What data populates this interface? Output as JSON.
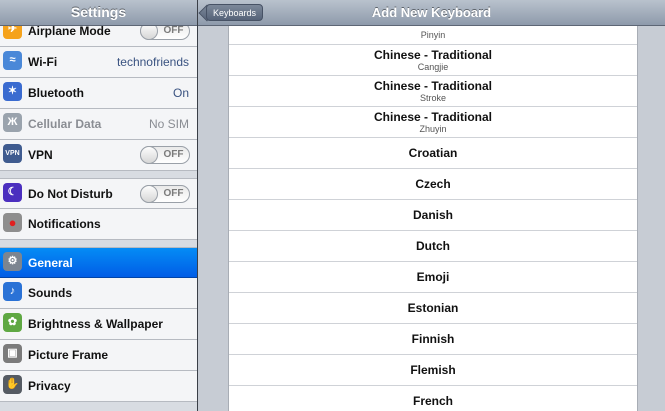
{
  "sidebar": {
    "title": "Settings",
    "items": [
      {
        "label": "Airplane Mode",
        "icon": "airplane-icon",
        "icon_color": "#f5a21b",
        "toggle": "OFF"
      },
      {
        "label": "Wi-Fi",
        "icon": "wifi-icon",
        "icon_color": "#4a88d8",
        "value": "technofriends"
      },
      {
        "label": "Bluetooth",
        "icon": "bluetooth-icon",
        "icon_color": "#3a6bd0",
        "value": "On"
      },
      {
        "label": "Cellular Data",
        "icon": "antenna-icon",
        "icon_color": "#9aa3ad",
        "value": "No SIM",
        "disabled": true
      },
      {
        "label": "VPN",
        "icon": "vpn-icon",
        "icon_color": "#3f5b8f",
        "toggle": "OFF"
      },
      {
        "label": "Do Not Disturb",
        "icon": "moon-icon",
        "icon_color": "#4b2fbf",
        "toggle": "OFF"
      },
      {
        "label": "Notifications",
        "icon": "notifications-icon",
        "icon_color": "#8e8e8e"
      },
      {
        "label": "General",
        "icon": "gear-icon",
        "icon_color": "#7c8590",
        "selected": true
      },
      {
        "label": "Sounds",
        "icon": "speaker-icon",
        "icon_color": "#2a72d6"
      },
      {
        "label": "Brightness & Wallpaper",
        "icon": "brightness-wallpaper-icon",
        "icon_color": "#5fa843"
      },
      {
        "label": "Picture Frame",
        "icon": "picture-frame-icon",
        "icon_color": "#7b7b7b"
      },
      {
        "label": "Privacy",
        "icon": "hand-icon",
        "icon_color": "#555b63"
      }
    ]
  },
  "navbar": {
    "back_label": "Keyboards",
    "title": "Add New Keyboard"
  },
  "keyboards": [
    {
      "name": "",
      "sub": "Pinyin"
    },
    {
      "name": "Chinese - Traditional",
      "sub": "Cangjie"
    },
    {
      "name": "Chinese - Traditional",
      "sub": "Stroke"
    },
    {
      "name": "Chinese - Traditional",
      "sub": "Zhuyin"
    },
    {
      "name": "Croatian"
    },
    {
      "name": "Czech"
    },
    {
      "name": "Danish"
    },
    {
      "name": "Dutch"
    },
    {
      "name": "Emoji"
    },
    {
      "name": "Estonian"
    },
    {
      "name": "Finnish"
    },
    {
      "name": "Flemish"
    },
    {
      "name": "French"
    }
  ]
}
